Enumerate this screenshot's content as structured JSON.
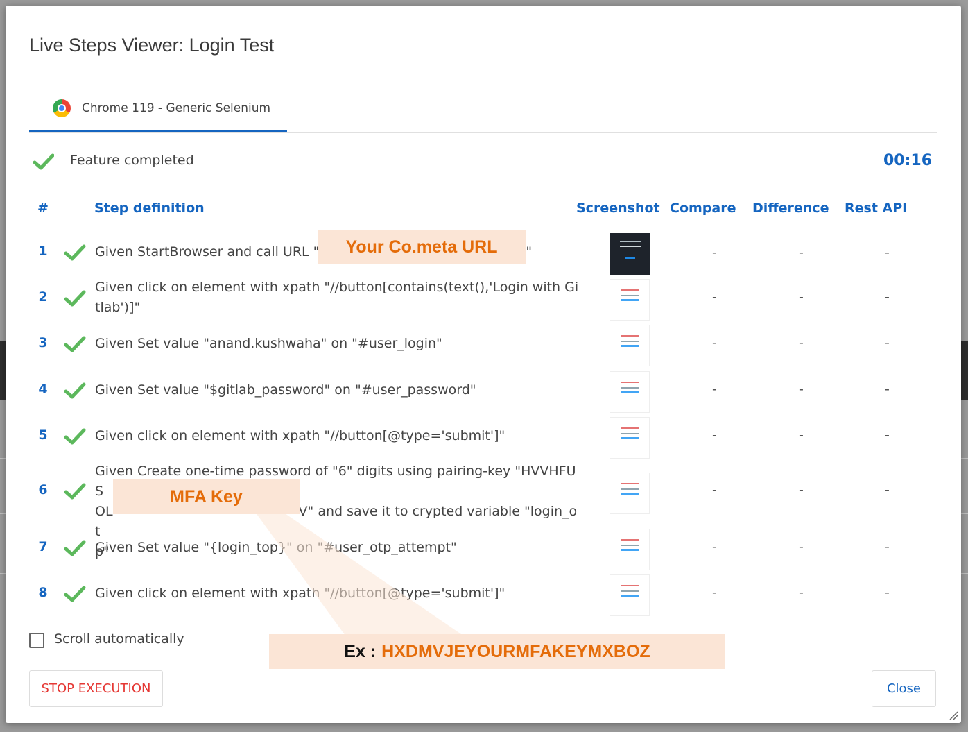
{
  "dialog": {
    "title": "Live Steps Viewer: Login Test",
    "tab": {
      "label": "Chrome 119 - Generic Selenium",
      "icon": "chrome-icon"
    },
    "status": {
      "text": "Feature completed",
      "timer": "00:16",
      "icon": "check-icon"
    },
    "columns": {
      "num": "#",
      "step": "Step definition",
      "screenshot": "Screenshot",
      "compare": "Compare",
      "difference": "Difference",
      "rest": "Rest API"
    },
    "steps": [
      {
        "num": "1",
        "text_pre": "Given StartBrowser and call URL \"",
        "text_post": "\"",
        "compare": "-",
        "difference": "-",
        "rest": "-"
      },
      {
        "num": "2",
        "text": "Given click on element with xpath \"//button[contains(text(),'Login with Gitlab')]\"",
        "compare": "-",
        "difference": "-",
        "rest": "-"
      },
      {
        "num": "3",
        "text": "Given Set value \"anand.kushwaha\" on \"#user_login\"",
        "compare": "-",
        "difference": "-",
        "rest": "-"
      },
      {
        "num": "4",
        "text": "Given Set value \"$gitlab_password\" on \"#user_password\"",
        "compare": "-",
        "difference": "-",
        "rest": "-"
      },
      {
        "num": "5",
        "text": "Given click on element with xpath \"//button[@type='submit']\"",
        "compare": "-",
        "difference": "-",
        "rest": "-"
      },
      {
        "num": "6",
        "line1": "Given Create one-time password of \"6\" digits using pairing-key \"HVVHFUS",
        "line2a": "OL",
        "line2b": "V\" and save it to crypted variable \"login_ot",
        "line3": "p\"",
        "compare": "-",
        "difference": "-",
        "rest": "-"
      },
      {
        "num": "7",
        "text": "Given Set value \"{login_top}\" on \"#user_otp_attempt\"",
        "compare": "-",
        "difference": "-",
        "rest": "-"
      },
      {
        "num": "8",
        "text": "Given click on element with xpath \"//button[@type='submit']\"",
        "compare": "-",
        "difference": "-",
        "rest": "-"
      }
    ],
    "scroll_label": "Scroll automatically",
    "stop_button": "STOP EXECUTION",
    "close_button": "Close"
  },
  "annotations": {
    "url_callout": "Your Co.meta URL",
    "mfa_callout": "MFA Key",
    "example_prefix": "Ex :",
    "example_value": "HXDMVJEYOURMFAKEYMXBOZ",
    "callout_color": "#e46c0a",
    "callout_bg": "#fbe5d6"
  }
}
